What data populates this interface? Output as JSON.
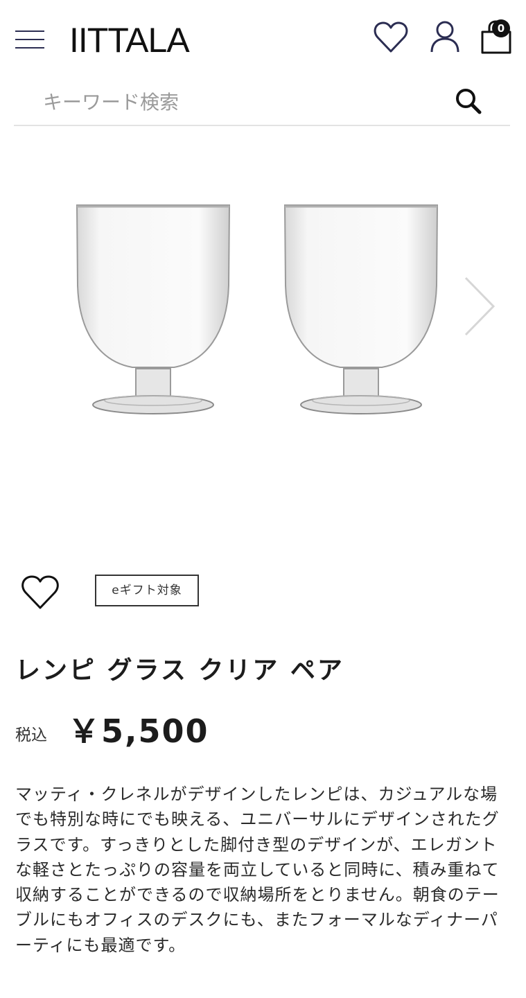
{
  "header": {
    "logo": "IITTALA",
    "cart_count": "0"
  },
  "search": {
    "placeholder": "キーワード検索"
  },
  "product": {
    "badge": "eギフト対象",
    "title": "レンピ グラス クリア ペア",
    "tax_label": "税込",
    "price": "￥5,500",
    "description": "マッティ・クレネルがデザインしたレンピは、カジュアルな場でも特別な時にでも映える、ユニバーサルにデザインされたグラスです。すっきりとした脚付き型のデザインが、エレガントな軽さとたっぷりの容量を両立していると同時に、積み重ねて収納することができるので収納場所をとりません。朝食のテーブルにもオフィスのデスクにも、またフォーマルなディナーパーティにも最適です。"
  },
  "icons": {
    "menu": "hamburger-menu-icon",
    "wishlist": "heart-icon",
    "account": "user-icon",
    "cart": "shopping-bag-icon",
    "search": "search-icon",
    "next": "chevron-right-icon"
  },
  "colors": {
    "accent": "#2b2d52",
    "text": "#1c1c1c",
    "divider": "#e3e3e3"
  }
}
